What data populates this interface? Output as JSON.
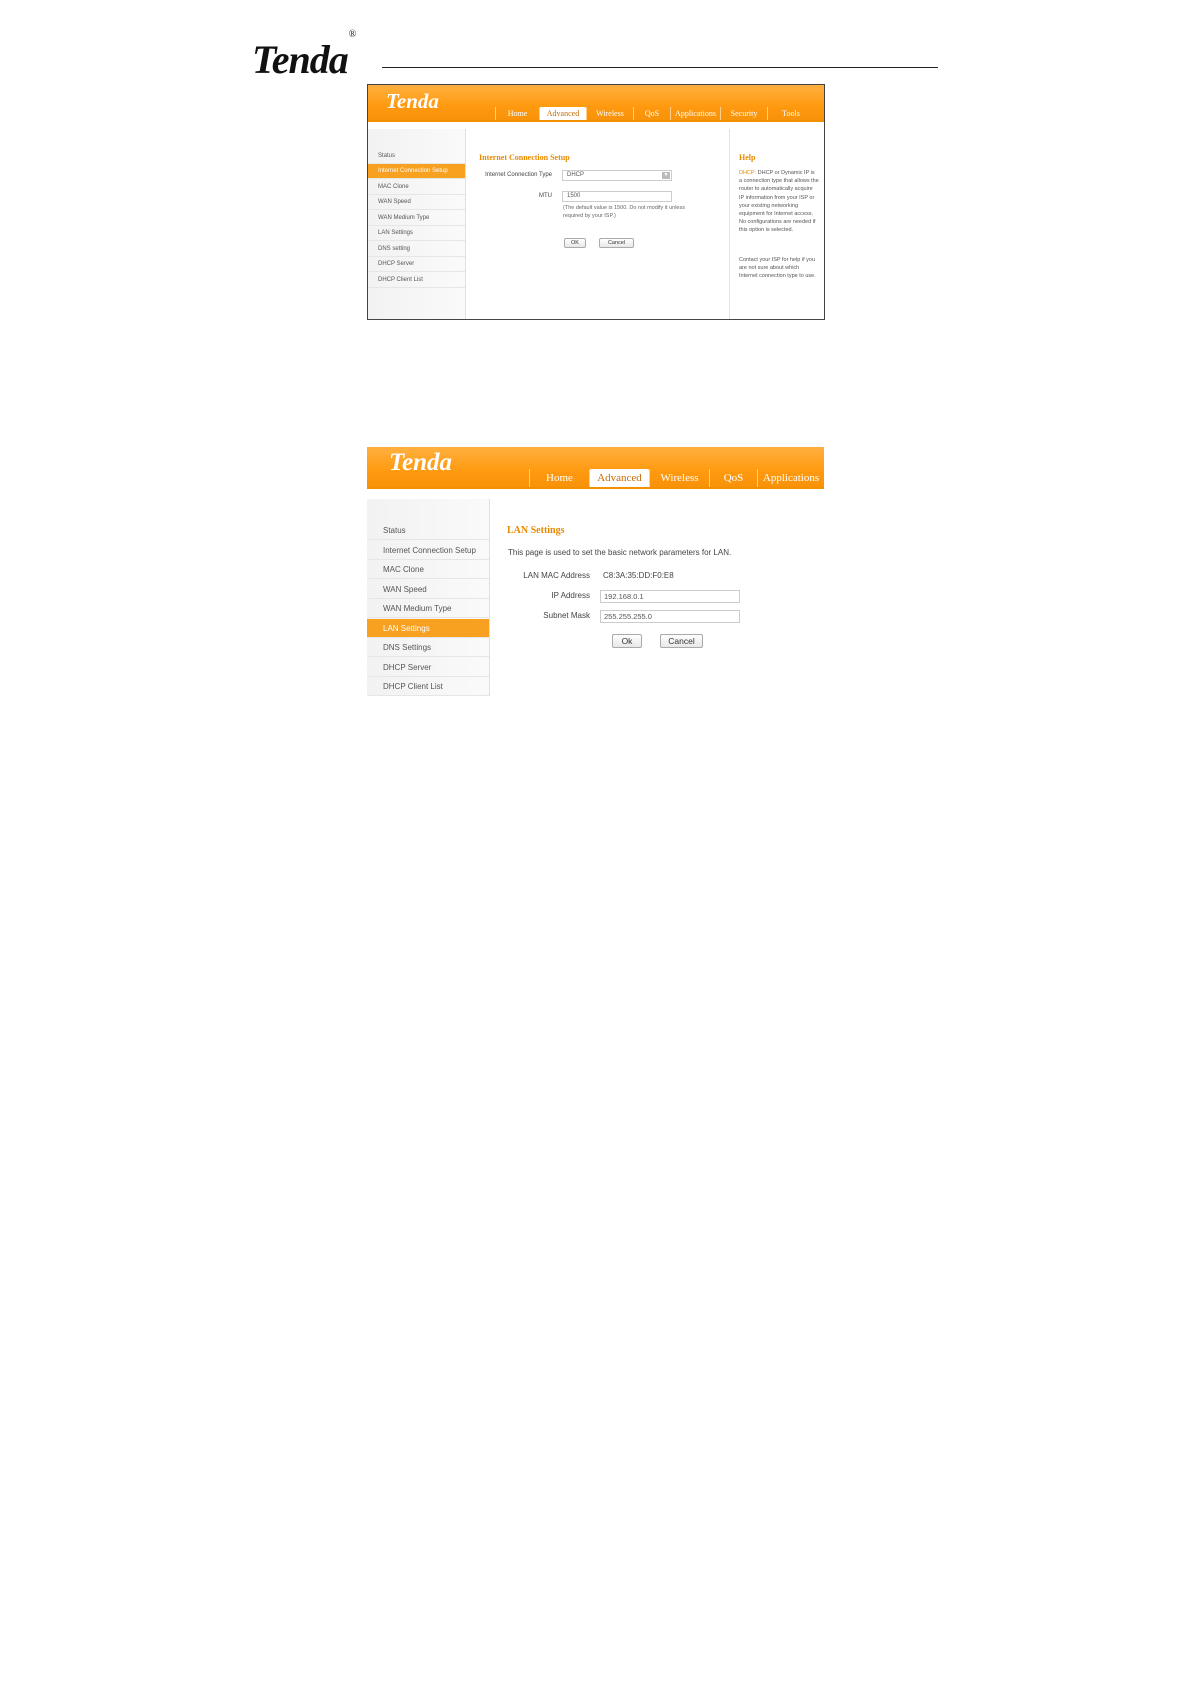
{
  "document": {
    "logo_text": "Tenda",
    "logo_mark": "®"
  },
  "shot1": {
    "brand": "Tenda",
    "tabs": [
      "Home",
      "Advanced",
      "Wireless",
      "QoS",
      "Applications",
      "Security",
      "Tools"
    ],
    "active_tab": "Advanced",
    "sidebar": [
      "Status",
      "Internet Connection Setup",
      "MAC Clone",
      "WAN Speed",
      "WAN Medium Type",
      "LAN Settings",
      "DNS setting",
      "DHCP Server",
      "DHCP Client List"
    ],
    "active_sidebar": "Internet Connection Setup",
    "section_title": "Internet Connection Setup",
    "connection_type_label": "Internet Connection Type",
    "connection_type_value": "DHCP",
    "mtu_label": "MTU",
    "mtu_value": "1500",
    "mtu_note": "(The default value is 1500. Do not modify it unless required by your ISP.)",
    "ok_label": "OK",
    "cancel_label": "Cancel",
    "help_title": "Help",
    "help_keyword": "DHCP:",
    "help_p1": " DHCP or Dynamic IP is a connection type that allows the router to automatically acquire IP information from your ISP or your existing networking equipment for Internet access. No configurations are needed if this option is selected.",
    "help_p2": "Contact your ISP for help if you are not sure about which Internet connection type to use."
  },
  "shot2": {
    "brand": "Tenda",
    "tabs": [
      "Home",
      "Advanced",
      "Wireless",
      "QoS",
      "Applications"
    ],
    "active_tab": "Advanced",
    "sidebar": [
      "Status",
      "Internet Connection Setup",
      "MAC Clone",
      "WAN Speed",
      "WAN Medium Type",
      "LAN Settings",
      "DNS Settings",
      "DHCP Server",
      "DHCP Client List"
    ],
    "active_sidebar": "LAN Settings",
    "section_title": "LAN Settings",
    "description": "This page is used to set the basic network parameters for LAN.",
    "mac_label": "LAN MAC Address",
    "mac_value": "C8:3A:35:DD:F0:E8",
    "ip_label": "IP Address",
    "ip_value": "192.168.0.1",
    "mask_label": "Subnet Mask",
    "mask_value": "255.255.255.0",
    "ok_label": "Ok",
    "cancel_label": "Cancel"
  },
  "colors": {
    "accent": "#f39000",
    "title": "#e88a00",
    "active_side": "#f8a020"
  }
}
